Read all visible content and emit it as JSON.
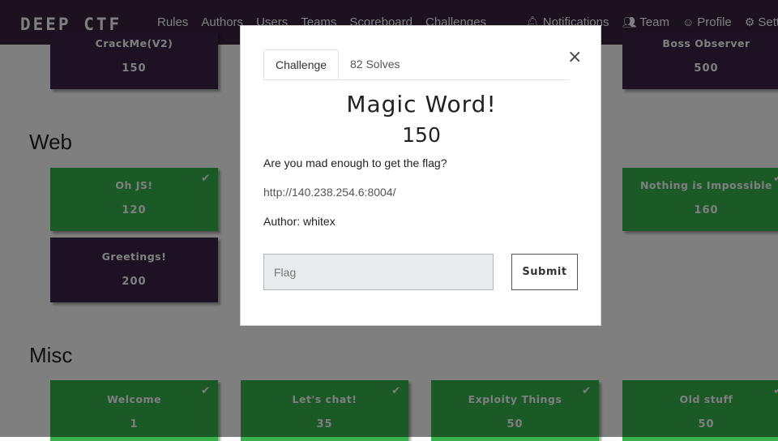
{
  "navbar": {
    "brand": "DEEP CTF",
    "left_items": [
      "Rules",
      "Authors",
      "Users",
      "Teams",
      "Scoreboard",
      "Challenges"
    ],
    "right_items": {
      "notifications": "Notifications",
      "team": "Team",
      "profile": "Profile",
      "settings": "Settings"
    },
    "icons": {
      "notifications": "bell-icon",
      "team": "users-icon",
      "profile": "user-circle-icon",
      "settings": "cogs-icon"
    }
  },
  "top_row": [
    {
      "name": "CrackMe(V2)",
      "value": "150",
      "solved": false
    },
    {
      "name": "Boss Observer",
      "value": "500",
      "solved": false
    }
  ],
  "sections": {
    "web": {
      "title": "Web",
      "challenges": [
        {
          "name": "Oh JS!",
          "value": "120",
          "solved": true
        },
        {
          "name": "Nothing is Impossible",
          "value": "160",
          "solved": true
        },
        {
          "name": "Greetings!",
          "value": "200",
          "solved": false
        }
      ]
    },
    "misc": {
      "title": "Misc",
      "challenges": [
        {
          "name": "Welcome",
          "value": "1",
          "solved": true
        },
        {
          "name": "Let's chat!",
          "value": "35",
          "solved": true
        },
        {
          "name": "Exploity Things",
          "value": "50",
          "solved": true
        },
        {
          "name": "Old stuff",
          "value": "50",
          "solved": true
        }
      ]
    }
  },
  "modal": {
    "tabs": {
      "challenge": "Challenge",
      "solves": "82 Solves"
    },
    "close_label": "×",
    "challenge_name": "Magic Word!",
    "challenge_value": "150",
    "description": "Are you mad enough to get the flag?",
    "link": "http://140.238.254.6:8004/",
    "author": "Author: whitex",
    "flag_placeholder": "Flag",
    "submit_label": "Submit"
  },
  "colors": {
    "navbar": "#36223f",
    "unsolved_card": "#3a2548",
    "solved_card": "#37b24d",
    "backdrop": "rgba(0,0,0,0.5)"
  }
}
